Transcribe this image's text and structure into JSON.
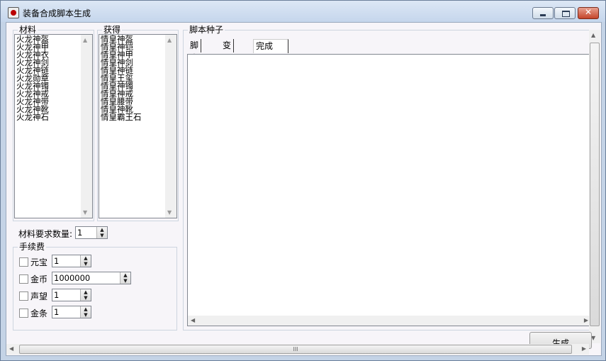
{
  "window": {
    "title": "装备合成脚本生成"
  },
  "materials": {
    "label": "材料",
    "items": [
      "火龙神盔",
      "火龙神甲",
      "火龙神衣",
      "火龙神剑",
      "火龙神链",
      "火龙勋章",
      "火龙神镯",
      "火龙神戒",
      "火龙神带",
      "火龙神靴",
      "火龙神石"
    ]
  },
  "obtained": {
    "label": "获得",
    "items": [
      "情皇神盔",
      "情皇神铠",
      "情皇神甲",
      "情皇神剑",
      "情皇神链",
      "情皇王玺",
      "情皇神镯",
      "情皇神戒",
      "情皇腰带",
      "情皇神靴",
      "情皇霸王石"
    ]
  },
  "quantity": {
    "label": "材料要求数量:",
    "value": "1"
  },
  "fees": {
    "label": "手续费",
    "rows": [
      {
        "label": "元宝",
        "value": "1"
      },
      {
        "label": "金币",
        "value": "1000000"
      },
      {
        "label": "声望",
        "value": "1"
      },
      {
        "label": "金条",
        "value": "1"
      }
    ]
  },
  "script_seed": {
    "label": "脚本种子",
    "tabs": [
      "脚本",
      "变量",
      "完成"
    ],
    "active_tab": "完成",
    "content": ""
  },
  "generate_button": {
    "label": "生成"
  },
  "scrollbar_grip": "III"
}
